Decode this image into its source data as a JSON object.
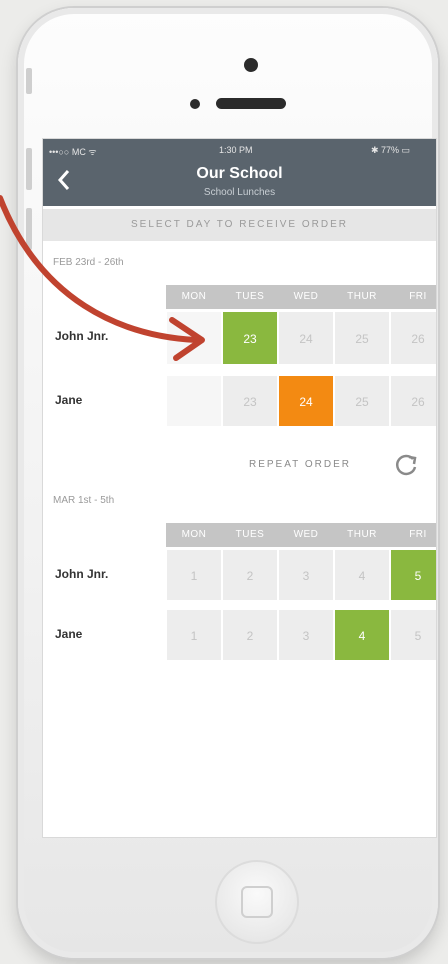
{
  "status_bar": {
    "carrier": "•••○○ MC ᯤ",
    "time": "1:30 PM",
    "battery": "✱ 77% ▭"
  },
  "nav": {
    "back_icon": "chevron-left-icon",
    "title": "Our School",
    "subtitle": "School Lunches"
  },
  "banner": "SELECT DAY TO RECEIVE ORDER",
  "days": [
    "MON",
    "TUES",
    "WED",
    "THUR",
    "FRI"
  ],
  "weeks": [
    {
      "label": "FEB 23rd - 26th",
      "rows": [
        {
          "name": "John Jnr.",
          "cells": [
            {
              "text": "",
              "state": "empty"
            },
            {
              "text": "23",
              "state": "selected-green"
            },
            {
              "text": "24",
              "state": "default"
            },
            {
              "text": "25",
              "state": "default"
            },
            {
              "text": "26",
              "state": "default"
            }
          ]
        },
        {
          "name": "Jane",
          "cells": [
            {
              "text": "",
              "state": "empty"
            },
            {
              "text": "23",
              "state": "default"
            },
            {
              "text": "24",
              "state": "selected-orange"
            },
            {
              "text": "25",
              "state": "default"
            },
            {
              "text": "26",
              "state": "default"
            }
          ]
        }
      ]
    },
    {
      "label": "MAR 1st - 5th",
      "rows": [
        {
          "name": "John Jnr.",
          "cells": [
            {
              "text": "1",
              "state": "default"
            },
            {
              "text": "2",
              "state": "default"
            },
            {
              "text": "3",
              "state": "default"
            },
            {
              "text": "4",
              "state": "default"
            },
            {
              "text": "5",
              "state": "selected-green"
            }
          ]
        },
        {
          "name": "Jane",
          "cells": [
            {
              "text": "1",
              "state": "default"
            },
            {
              "text": "2",
              "state": "default"
            },
            {
              "text": "3",
              "state": "default"
            },
            {
              "text": "4",
              "state": "selected-green"
            },
            {
              "text": "5",
              "state": "default"
            }
          ]
        }
      ]
    }
  ],
  "repeat": {
    "label": "REPEAT ORDER",
    "icon": "refresh-icon"
  },
  "colors": {
    "green": "#8ab83f",
    "orange": "#f38a12",
    "nav": "#5a646d",
    "arrow": "#c0432f"
  }
}
